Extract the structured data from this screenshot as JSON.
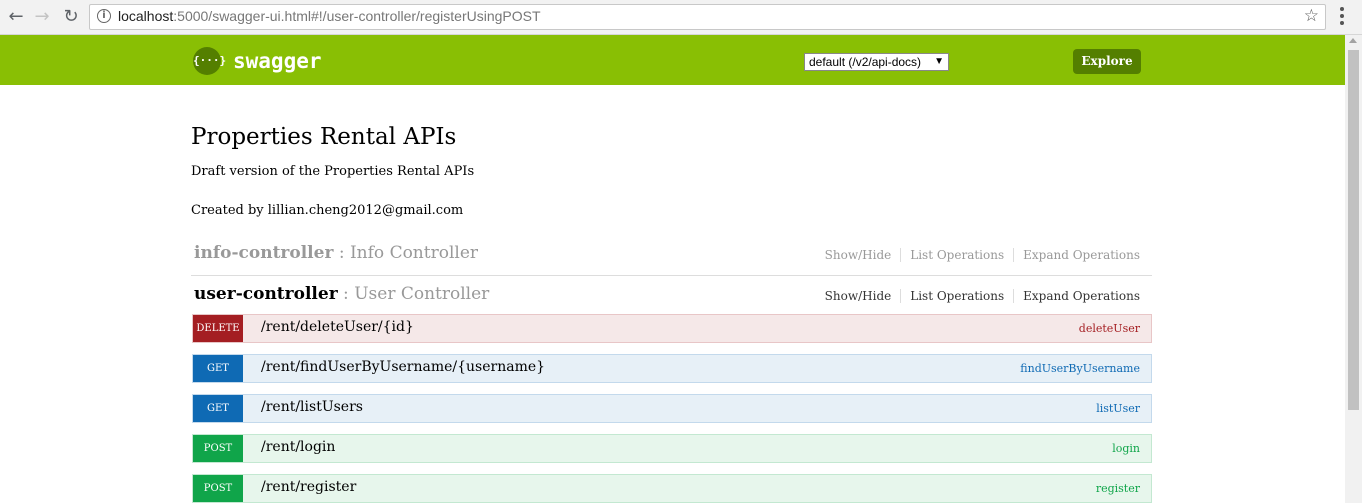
{
  "browser": {
    "url_host": "localhost",
    "url_rest": ":5000/swagger-ui.html#!/user-controller/registerUsingPOST",
    "back_glyph": "←",
    "forward_glyph": "→",
    "reload_glyph": "↻",
    "info_glyph": "i",
    "star_glyph": "☆"
  },
  "header": {
    "logo_glyph": "{···}",
    "logo_text": "swagger",
    "api_select_value": "default (/v2/api-docs)",
    "api_select_caret": "▼",
    "explore_label": "Explore",
    "background_color": "#89bf04"
  },
  "info": {
    "title": "Properties Rental APIs",
    "description": "Draft version of the Properties Rental APIs",
    "contact": "Created by lillian.cheng2012@gmail.com"
  },
  "resources": [
    {
      "name": "info-controller",
      "separator": " : ",
      "description": "Info Controller",
      "ops": [
        "Show/Hide",
        "List Operations",
        "Expand Operations"
      ]
    },
    {
      "name": "user-controller",
      "separator": " : ",
      "description": "User Controller",
      "ops": [
        "Show/Hide",
        "List Operations",
        "Expand Operations"
      ]
    }
  ],
  "operations": [
    {
      "method": "DELETE",
      "path": "/rent/deleteUser/{id}",
      "nickname": "deleteUser",
      "color": "#a41e22"
    },
    {
      "method": "GET",
      "path": "/rent/findUserByUsername/{username}",
      "nickname": "findUserByUsername",
      "color": "#0f6ab4"
    },
    {
      "method": "GET",
      "path": "/rent/listUsers",
      "nickname": "listUser",
      "color": "#0f6ab4"
    },
    {
      "method": "POST",
      "path": "/rent/login",
      "nickname": "login",
      "color": "#10a54a"
    },
    {
      "method": "POST",
      "path": "/rent/register",
      "nickname": "register",
      "color": "#10a54a"
    }
  ]
}
